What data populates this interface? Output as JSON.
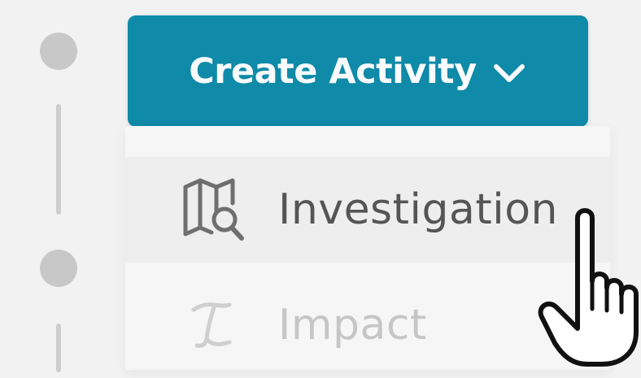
{
  "create_button": {
    "label": "Create Activity",
    "color": "#0f8aa8",
    "icon": "chevron-down-icon"
  },
  "menu": {
    "items": [
      {
        "label": "Investigation",
        "icon": "map-search-icon",
        "state": "hovered"
      },
      {
        "label": "Impact",
        "icon": "integral-icon",
        "state": "disabled"
      }
    ]
  },
  "cursor": {
    "icon": "hand-pointer-icon"
  }
}
